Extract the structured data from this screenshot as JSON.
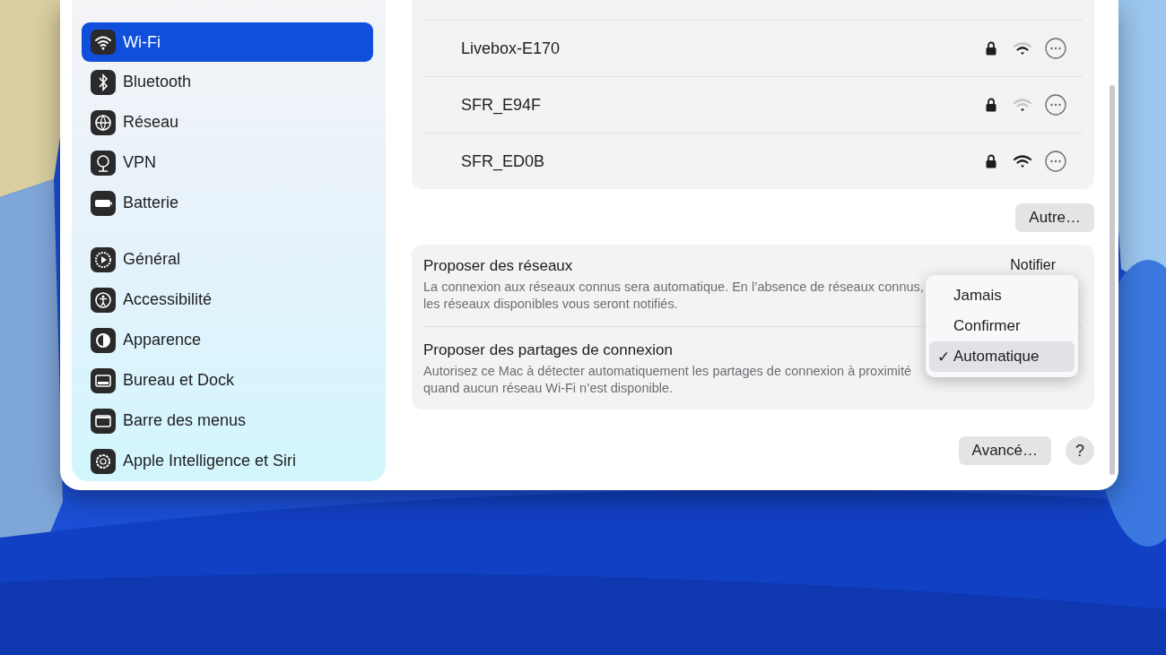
{
  "sidebar": {
    "groups": [
      {
        "items": [
          {
            "label": "Wi-Fi",
            "selected": true
          },
          {
            "label": "Bluetooth",
            "selected": false
          },
          {
            "label": "Réseau",
            "selected": false
          },
          {
            "label": "VPN",
            "selected": false
          },
          {
            "label": "Batterie",
            "selected": false
          }
        ]
      },
      {
        "items": [
          {
            "label": "Général",
            "selected": false
          },
          {
            "label": "Accessibilité",
            "selected": false
          },
          {
            "label": "Apparence",
            "selected": false
          },
          {
            "label": "Bureau et Dock",
            "selected": false
          },
          {
            "label": "Barre des menus",
            "selected": false
          },
          {
            "label": "Apple Intelligence et Siri",
            "selected": false
          }
        ]
      }
    ]
  },
  "networks": [
    {
      "name": "Livebox-E170",
      "locked": true,
      "kind": "medium"
    },
    {
      "name": "SFR_E94F",
      "locked": true,
      "kind": "weak"
    },
    {
      "name": "SFR_ED0B",
      "locked": true,
      "kind": "strong"
    }
  ],
  "other_button": "Autre…",
  "settings": [
    {
      "title": "Proposer des réseaux",
      "description": "La connexion aux réseaux connus sera automatique. En l’absence de réseaux connus, les réseaux disponibles vous seront notifiés.",
      "value": "Notifier"
    },
    {
      "title": "Proposer des partages de connexion",
      "description": "Autorisez ce Mac à détecter automatiquement les partages de connexion à proximité quand aucun réseau Wi-Fi n’est disponible."
    }
  ],
  "popup_menu": {
    "options": [
      {
        "label": "Jamais",
        "selected": false
      },
      {
        "label": "Confirmer",
        "selected": false
      },
      {
        "label": "Automatique",
        "selected": true
      }
    ],
    "check": "✓"
  },
  "advanced_button": "Avancé…",
  "help_button": "?"
}
